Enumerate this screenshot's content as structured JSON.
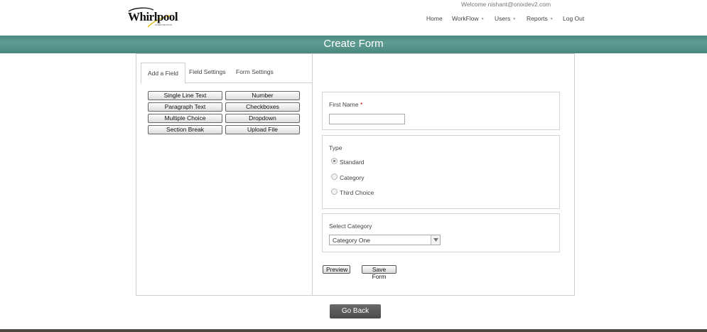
{
  "header": {
    "logo_text": "Whirlpool",
    "logo_sub": "CORPORATION",
    "welcome": "Welcome nishant@onixdev2.com",
    "nav": [
      {
        "label": "Home"
      },
      {
        "label": "WorkFlow"
      },
      {
        "label": "Users"
      },
      {
        "label": "Reports"
      },
      {
        "label": "Log Out"
      }
    ]
  },
  "banner": {
    "title": "Create Form"
  },
  "tabs": [
    {
      "label": "Add a Field"
    },
    {
      "label": "Field Settings"
    },
    {
      "label": "Form Settings"
    }
  ],
  "field_buttons": [
    "Single Line Text",
    "Number",
    "Paragraph Text",
    "Checkboxes",
    "Multiple Choice",
    "Dropdown",
    "Section Break",
    "Upload File"
  ],
  "form": {
    "first_name": {
      "label": "First Name",
      "required_mark": "*",
      "value": ""
    },
    "type": {
      "label": "Type",
      "options": [
        "Standard",
        "Category",
        "Third Choice"
      ],
      "selected": "Standard"
    },
    "category": {
      "label": "Select Category",
      "value": "Category One"
    }
  },
  "actions": {
    "preview": "Preview",
    "save": "Save Form",
    "go_back": "Go Back"
  },
  "colors": {
    "banner": "#5f9c92",
    "footer": "#4e4a3f",
    "go_back": "#555555"
  }
}
